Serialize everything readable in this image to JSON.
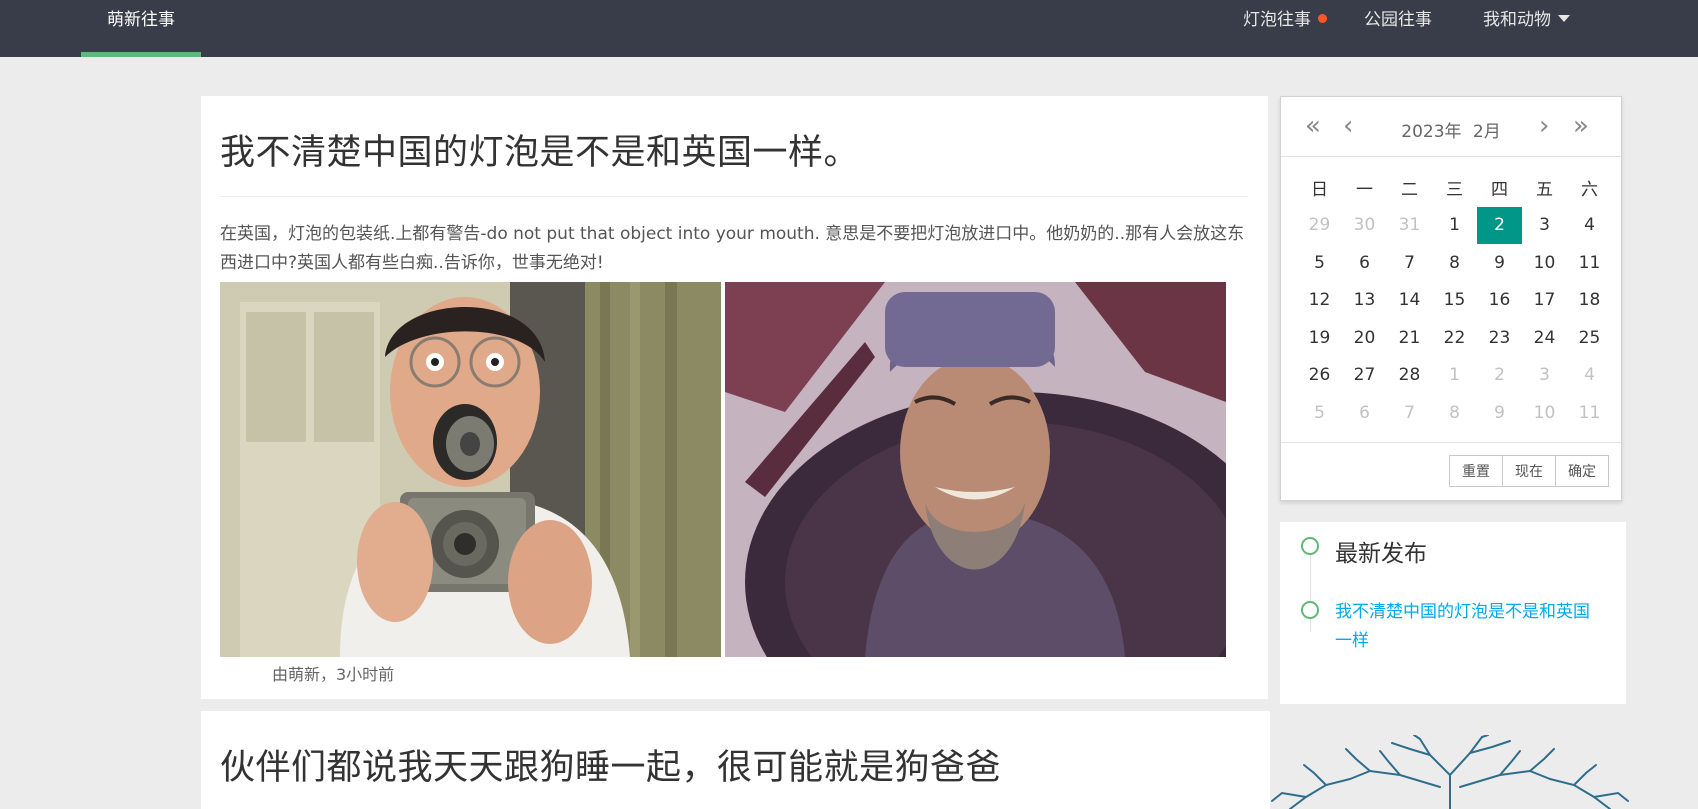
{
  "nav": {
    "brand": "萌新往事",
    "items": [
      {
        "label": "灯泡往事",
        "has_dot": true
      },
      {
        "label": "公园往事"
      },
      {
        "label": "我和动物",
        "has_caret": true
      }
    ]
  },
  "posts": [
    {
      "title": "我不清楚中国的灯泡是不是和英国一样。",
      "body": "在英国，灯泡的包装纸.上都有警告-do not put that object into your mouth. 意思是不要把灯泡放进口中。他奶奶的..那有人会放这东西进口中?英国人都有些白痴..告诉你，世事无绝对!",
      "meta": "由萌新，3小时前"
    },
    {
      "title": "伙伴们都说我天天跟狗睡一起，很可能就是狗爸爸"
    }
  ],
  "calendar": {
    "year": "2023年",
    "month": "2月",
    "weekdays": [
      "日",
      "一",
      "二",
      "三",
      "四",
      "五",
      "六"
    ],
    "weeks": [
      [
        "29",
        "30",
        "31",
        "1",
        "2",
        "3",
        "4"
      ],
      [
        "5",
        "6",
        "7",
        "8",
        "9",
        "10",
        "11"
      ],
      [
        "12",
        "13",
        "14",
        "15",
        "16",
        "17",
        "18"
      ],
      [
        "19",
        "20",
        "21",
        "22",
        "23",
        "24",
        "25"
      ],
      [
        "26",
        "27",
        "28",
        "1",
        "2",
        "3",
        "4"
      ],
      [
        "5",
        "6",
        "7",
        "8",
        "9",
        "10",
        "11"
      ]
    ],
    "selected": "2",
    "buttons": {
      "reset": "重置",
      "now": "现在",
      "confirm": "确定"
    }
  },
  "latest": {
    "title": "最新发布",
    "link": "我不清楚中国的灯泡是不是和英国一样"
  },
  "colors": {
    "nav_bg": "#393d49",
    "accent_green": "#5fb878",
    "selected_teal": "#009688",
    "link_blue": "#01aaed",
    "badge_dot": "#ff5722"
  }
}
